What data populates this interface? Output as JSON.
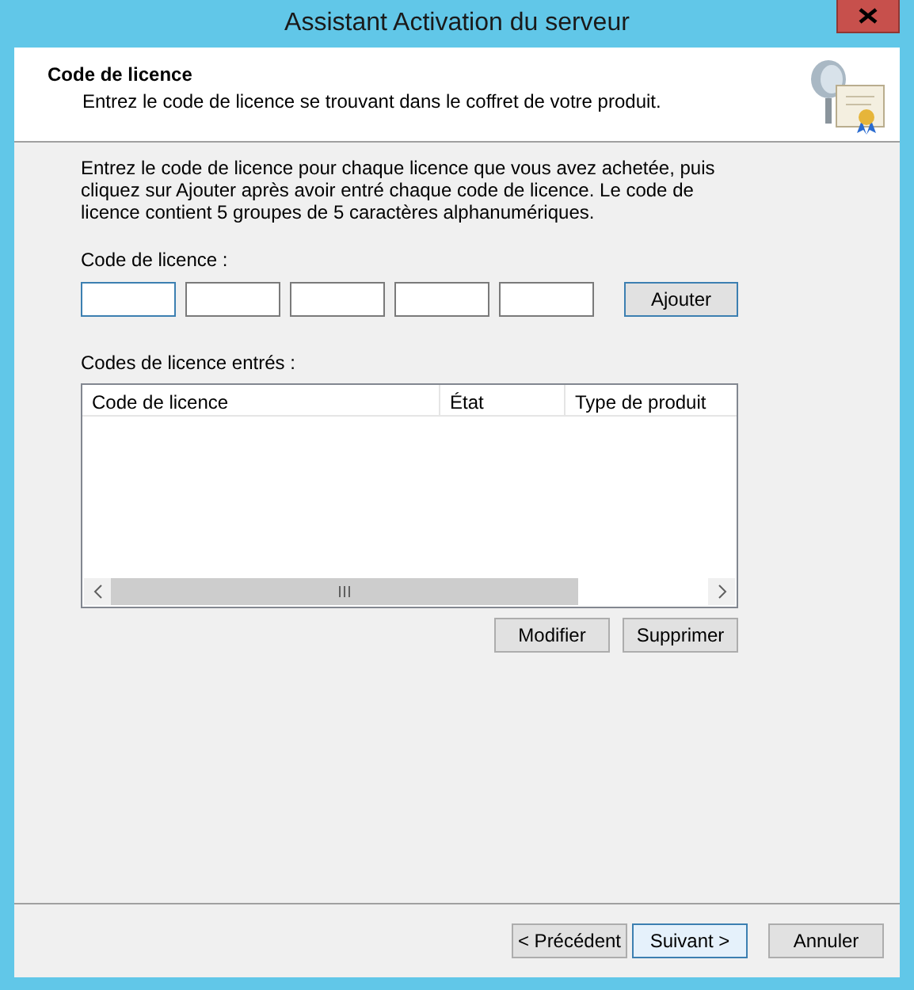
{
  "window": {
    "title": "Assistant Activation du serveur"
  },
  "header": {
    "title": "Code de licence",
    "subtitle": "Entrez le code de licence se trouvant dans le coffret de votre produit."
  },
  "instructions": "Entrez le code de licence pour chaque licence que vous avez achetée, puis cliquez sur Ajouter après avoir entré chaque code de licence. Le code de licence contient 5 groupes de 5 caractères alphanumériques.",
  "code_label": "Code de licence :",
  "code_fields": [
    {
      "focused": true
    },
    {
      "focused": false
    },
    {
      "focused": false
    },
    {
      "focused": false
    },
    {
      "focused": false
    }
  ],
  "add_button": {
    "label": "Ajouter"
  },
  "list_label": "Codes de licence entrés :",
  "table": {
    "columns": [
      "Code de licence",
      "État",
      "Type de produit"
    ]
  },
  "table_buttons": [
    {
      "label": "Modifier",
      "focused": false
    },
    {
      "label": "Supprimer",
      "focused": false
    }
  ],
  "footer_buttons": [
    {
      "label": "< Précédent",
      "focused": false
    },
    {
      "label": "Suivant >",
      "focused": true
    },
    {
      "label": "Annuler",
      "focused": false
    }
  ]
}
